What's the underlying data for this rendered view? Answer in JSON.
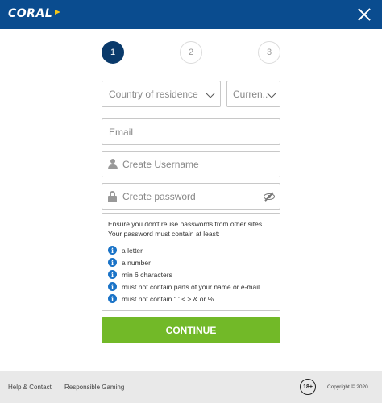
{
  "header": {
    "logo_text": "CORAL",
    "brand_color": "#0a4c8f"
  },
  "steps": {
    "step1": "1",
    "step2": "2",
    "step3": "3",
    "active": "1"
  },
  "form": {
    "country_placeholder": "Country of residence",
    "currency_placeholder": "Curren...",
    "email_placeholder": "Email",
    "username_placeholder": "Create Username",
    "password_placeholder": "Create password"
  },
  "password_rules": {
    "intro_line1": "Ensure you don't reuse passwords from other sites.",
    "intro_line2": "Your password must contain at least:",
    "items": [
      "a letter",
      "a number",
      "min 6 characters",
      "must not contain parts of your name or e-mail",
      "must not contain \" ' < > & or %"
    ]
  },
  "buttons": {
    "continue_label": "CONTINUE",
    "continue_color": "#72b928"
  },
  "footer": {
    "help_link": "Help & Contact",
    "responsible_link": "Responsible Gaming",
    "age_badge": "18+",
    "copyright": "Copyright © 2020"
  },
  "icons": [
    "close-icon",
    "chevron-down-icon",
    "user-icon",
    "lock-icon",
    "eye-slash-icon",
    "info-icon"
  ]
}
